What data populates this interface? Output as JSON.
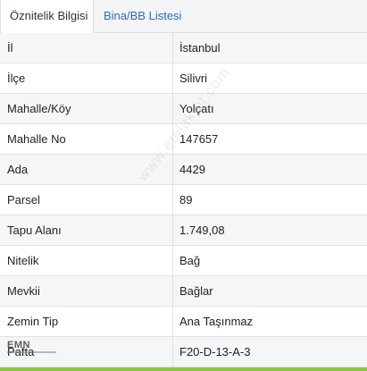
{
  "tabs": [
    {
      "label": "Öznitelik Bilgisi",
      "active": true
    },
    {
      "label": "Bina/BB Listesi",
      "active": false
    }
  ],
  "rows": [
    {
      "label": "İl",
      "value": "İstanbul"
    },
    {
      "label": "İlçe",
      "value": "Silivri"
    },
    {
      "label": "Mahalle/Köy",
      "value": "Yolçatı"
    },
    {
      "label": "Mahalle No",
      "value": "147657"
    },
    {
      "label": "Ada",
      "value": "4429"
    },
    {
      "label": "Parsel",
      "value": "89"
    },
    {
      "label": "Tapu Alanı",
      "value": "1.749,08"
    },
    {
      "label": "Nitelik",
      "value": "Bağ"
    },
    {
      "label": "Mevkii",
      "value": "Bağlar"
    },
    {
      "label": "Zemin Tip",
      "value": "Ana Taşınmaz"
    },
    {
      "label": "Pafta",
      "value": "F20-D-13-A-3"
    }
  ],
  "watermark": {
    "text": "www.emlakjet.com",
    "logo": "EMN"
  },
  "colors": {
    "link": "#2d6db5",
    "accent_bar": "#8dc63f"
  }
}
